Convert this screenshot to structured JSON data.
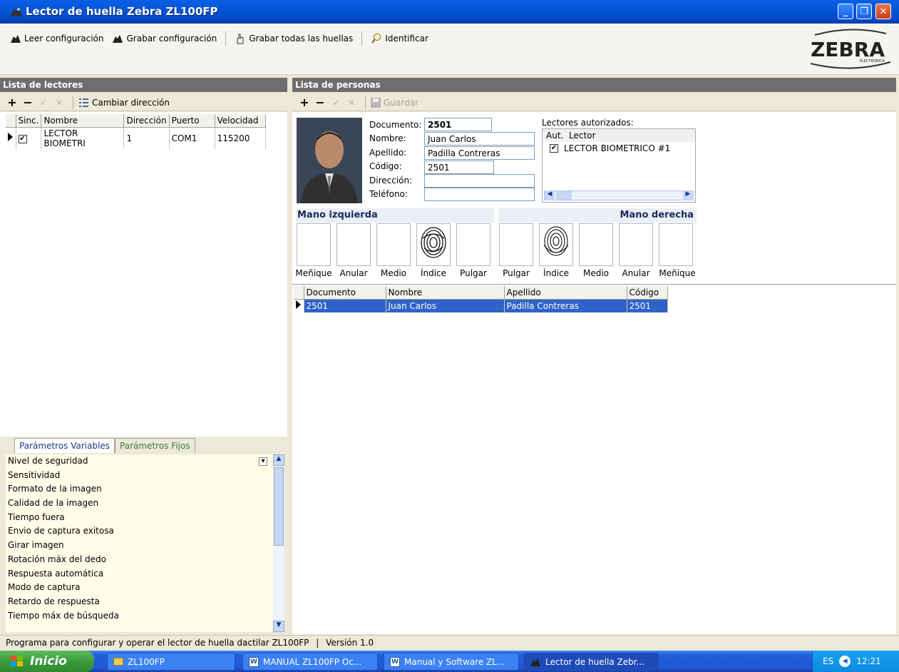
{
  "window": {
    "title": "Lector de huella Zebra ZL100FP"
  },
  "toolbar": {
    "read_config": "Leer configuración",
    "write_config": "Grabar configuración",
    "write_all": "Grabar todas las huellas",
    "identify": "Identificar"
  },
  "logo": {
    "text": "ZEBRA",
    "sub": "ELECTRÓNICA"
  },
  "readers": {
    "header": "Lista de lectores",
    "change_address": "Cambiar dirección",
    "columns": [
      "Sinc.",
      "Nombre",
      "Dirección",
      "Puerto",
      "Velocidad"
    ],
    "rows": [
      {
        "sync": "✔",
        "name": "LECTOR BIOMETRI",
        "address": "1",
        "port": "COM1",
        "speed": "115200"
      }
    ]
  },
  "params": {
    "tab_variable": "Parámetros Variables",
    "tab_fixed": "Parámetros Fijos",
    "items": [
      "Nivel de seguridad",
      "Sensitividad",
      "Formato de la imagen",
      "Calidad de la imagen",
      "Tiempo fuera",
      "Envio de captura exitosa",
      "Girar imagen",
      "Rotación máx del dedo",
      "Respuesta automática",
      "Modo de captura",
      "Retardo de respuesta",
      "Tiempo máx de búsqueda"
    ]
  },
  "persons": {
    "header": "Lista de personas",
    "save": "Guardar",
    "form": {
      "documento_label": "Documento:",
      "documento": "2501",
      "nombre_label": "Nombre:",
      "nombre": "Juan Carlos",
      "apellido_label": "Apellido:",
      "apellido": "Padilla Contreras",
      "codigo_label": "Código:",
      "codigo": "2501",
      "direccion_label": "Dirección:",
      "direccion": "",
      "telefono_label": "Teléfono:",
      "telefono": ""
    },
    "authorized": {
      "label": "Lectores autorizados:",
      "col_aut": "Aut.",
      "col_lector": "Lector",
      "rows": [
        {
          "aut": "✔",
          "lector": "LECTOR BIOMETRICO #1"
        }
      ]
    },
    "hands": {
      "left": "Mano izquierda",
      "right": "Mano derecha",
      "left_fingers": [
        "Meñique",
        "Anular",
        "Medio",
        "Índice",
        "Pulgar"
      ],
      "right_fingers": [
        "Pulgar",
        "Índice",
        "Medio",
        "Anular",
        "Meñique"
      ]
    },
    "table": {
      "columns": [
        "Documento",
        "Nombre",
        "Apellido",
        "Código"
      ],
      "rows": [
        {
          "documento": "2501",
          "nombre": "Juan Carlos",
          "apellido": "Padilla Contreras",
          "codigo": "2501"
        }
      ]
    }
  },
  "status": {
    "text": "Programa para configurar y operar el lector de huella dactilar ZL100FP",
    "version": "Versión 1.0"
  },
  "taskbar": {
    "start": "Inicio",
    "tasks": [
      "ZL100FP",
      "MANUAL ZL100FP Oc...",
      "Manual y Software ZL...",
      "Lector de huella Zebr..."
    ],
    "lang": "ES",
    "clock": "12:21"
  },
  "colors": {
    "accent": "#2f63c7",
    "titlebar": "#0555d6",
    "panel_header": "#6e6e6e"
  }
}
